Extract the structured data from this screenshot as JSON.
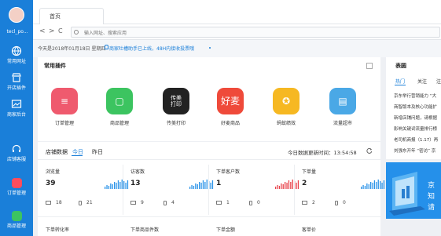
{
  "sidebar": {
    "username": "tecl_po...",
    "items": [
      {
        "label": "常用网址"
      },
      {
        "label": "开店插件"
      },
      {
        "label": "商家后台"
      },
      {
        "label": "店铺客服"
      },
      {
        "label": "订单管理"
      },
      {
        "label": "商品管理"
      }
    ]
  },
  "tabs": {
    "home": "首页"
  },
  "addressbar": {
    "back": "<",
    "forward": ">",
    "refresh": "C",
    "placeholder": "输入网址、搜索应用"
  },
  "info": {
    "date": "今天是2018年01月18日 星期四",
    "notice": "商家吐槽助手已上线，48H内接收投票哦"
  },
  "plugins": {
    "title": "常用插件",
    "items": [
      {
        "label": "订单管理",
        "color": "#ef5a6e",
        "glyph": "≡"
      },
      {
        "label": "商品管理",
        "color": "#3cc460",
        "glyph": "▢"
      },
      {
        "label": "传美打印",
        "color": "#222222",
        "glyph": "传美\n打印"
      },
      {
        "label": "好麦商品",
        "color": "#ef4a3a",
        "glyph": "好麦"
      },
      {
        "label": "蚂蚁绩效",
        "color": "#f6b822",
        "glyph": "✪"
      },
      {
        "label": "流量超市",
        "color": "#4aa8e6",
        "glyph": "▤"
      }
    ]
  },
  "stats": {
    "title": "店铺数据",
    "tab_today": "今日",
    "tab_yesterday": "昨日",
    "updated": "今日数据更新时间：13:54:58",
    "metrics": [
      {
        "title": "浏览量",
        "value": "39",
        "pc": "18",
        "mobile": "21",
        "color": "#2b93e8"
      },
      {
        "title": "访客数",
        "value": "13",
        "pc": "9",
        "mobile": "4",
        "color": "#2b93e8"
      },
      {
        "title": "下单客户数",
        "value": "1",
        "pc": "1",
        "mobile": "0",
        "color": "#e8434b"
      },
      {
        "title": "下单量",
        "value": "2",
        "pc": "2",
        "mobile": "0",
        "color": "#2b93e8"
      }
    ],
    "bottom_labels": [
      "下单转化率",
      "下单商品件数",
      "下单金额",
      "客单价"
    ]
  },
  "right": {
    "title": "表圆",
    "tabs": [
      "热门",
      "关注",
      "注"
    ],
    "news": [
      "京东举行营销能力 “大",
      "商智版本及核心功能扩",
      "新增店铺问题，请根据",
      "影响关键词流量排行榜",
      "老司机商报（1.17）再",
      "刘强东开年 “密访” 京"
    ],
    "banner_text": [
      "京",
      "知",
      "请"
    ]
  }
}
